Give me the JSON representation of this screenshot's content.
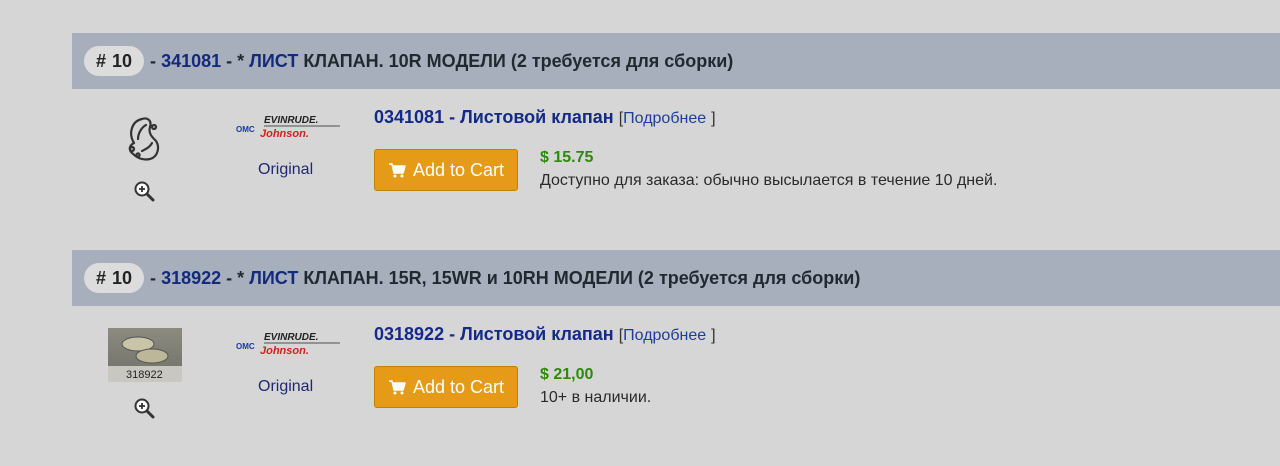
{
  "items": [
    {
      "badge_hash": "#",
      "badge_number": "10",
      "dash1": "-",
      "part_number": "341081",
      "dash2": "-",
      "asterisk": "*",
      "title_highlight": "ЛИСТ",
      "title_rest": "КЛАПАН. 10R МОДЕЛИ (2 требуется для сборки)",
      "product_link": "0341081 - Листовой клапан",
      "bracket_open": "[",
      "more_label": "Подробнее",
      "bracket_close": "]",
      "brand_small": "OMC",
      "brand_top": "EVINRUDE.",
      "brand_bottom": "Johnson.",
      "original_label": "Original",
      "add_to_cart_label": "Add to Cart",
      "price": "$ 15.75",
      "availability": "Доступно для заказа: обычно высылается в течение 10 дней.",
      "thumb_icon": "gasket-drawing-icon",
      "zoom_icon": "zoom-in-icon",
      "cart_icon": "cart-icon"
    },
    {
      "badge_hash": "#",
      "badge_number": "10",
      "dash1": "-",
      "part_number": "318922",
      "dash2": "-",
      "asterisk": "*",
      "title_highlight": "ЛИСТ",
      "title_rest": "КЛАПАН. 15R, 15WR и 10RH МОДЕЛИ (2 требуется для сборки)",
      "product_link": "0318922 - Листовой клапан",
      "bracket_open": "[",
      "more_label": "Подробнее",
      "bracket_close": "]",
      "brand_small": "OMC",
      "brand_top": "EVINRUDE.",
      "brand_bottom": "Johnson.",
      "original_label": "Original",
      "add_to_cart_label": "Add to Cart",
      "price": "$ 21,00",
      "availability": "10+ в наличии.",
      "thumb_caption": "318922",
      "thumb_icon": "reed-valve-photo",
      "zoom_icon": "zoom-in-icon",
      "cart_icon": "cart-icon"
    }
  ],
  "colors": {
    "header_bg": "#a7aebc",
    "page_bg": "#d6d6d6",
    "link": "#142a8a",
    "price": "#2d8a0a",
    "cart_button": "#e59b17",
    "brand_red": "#d0211c"
  }
}
